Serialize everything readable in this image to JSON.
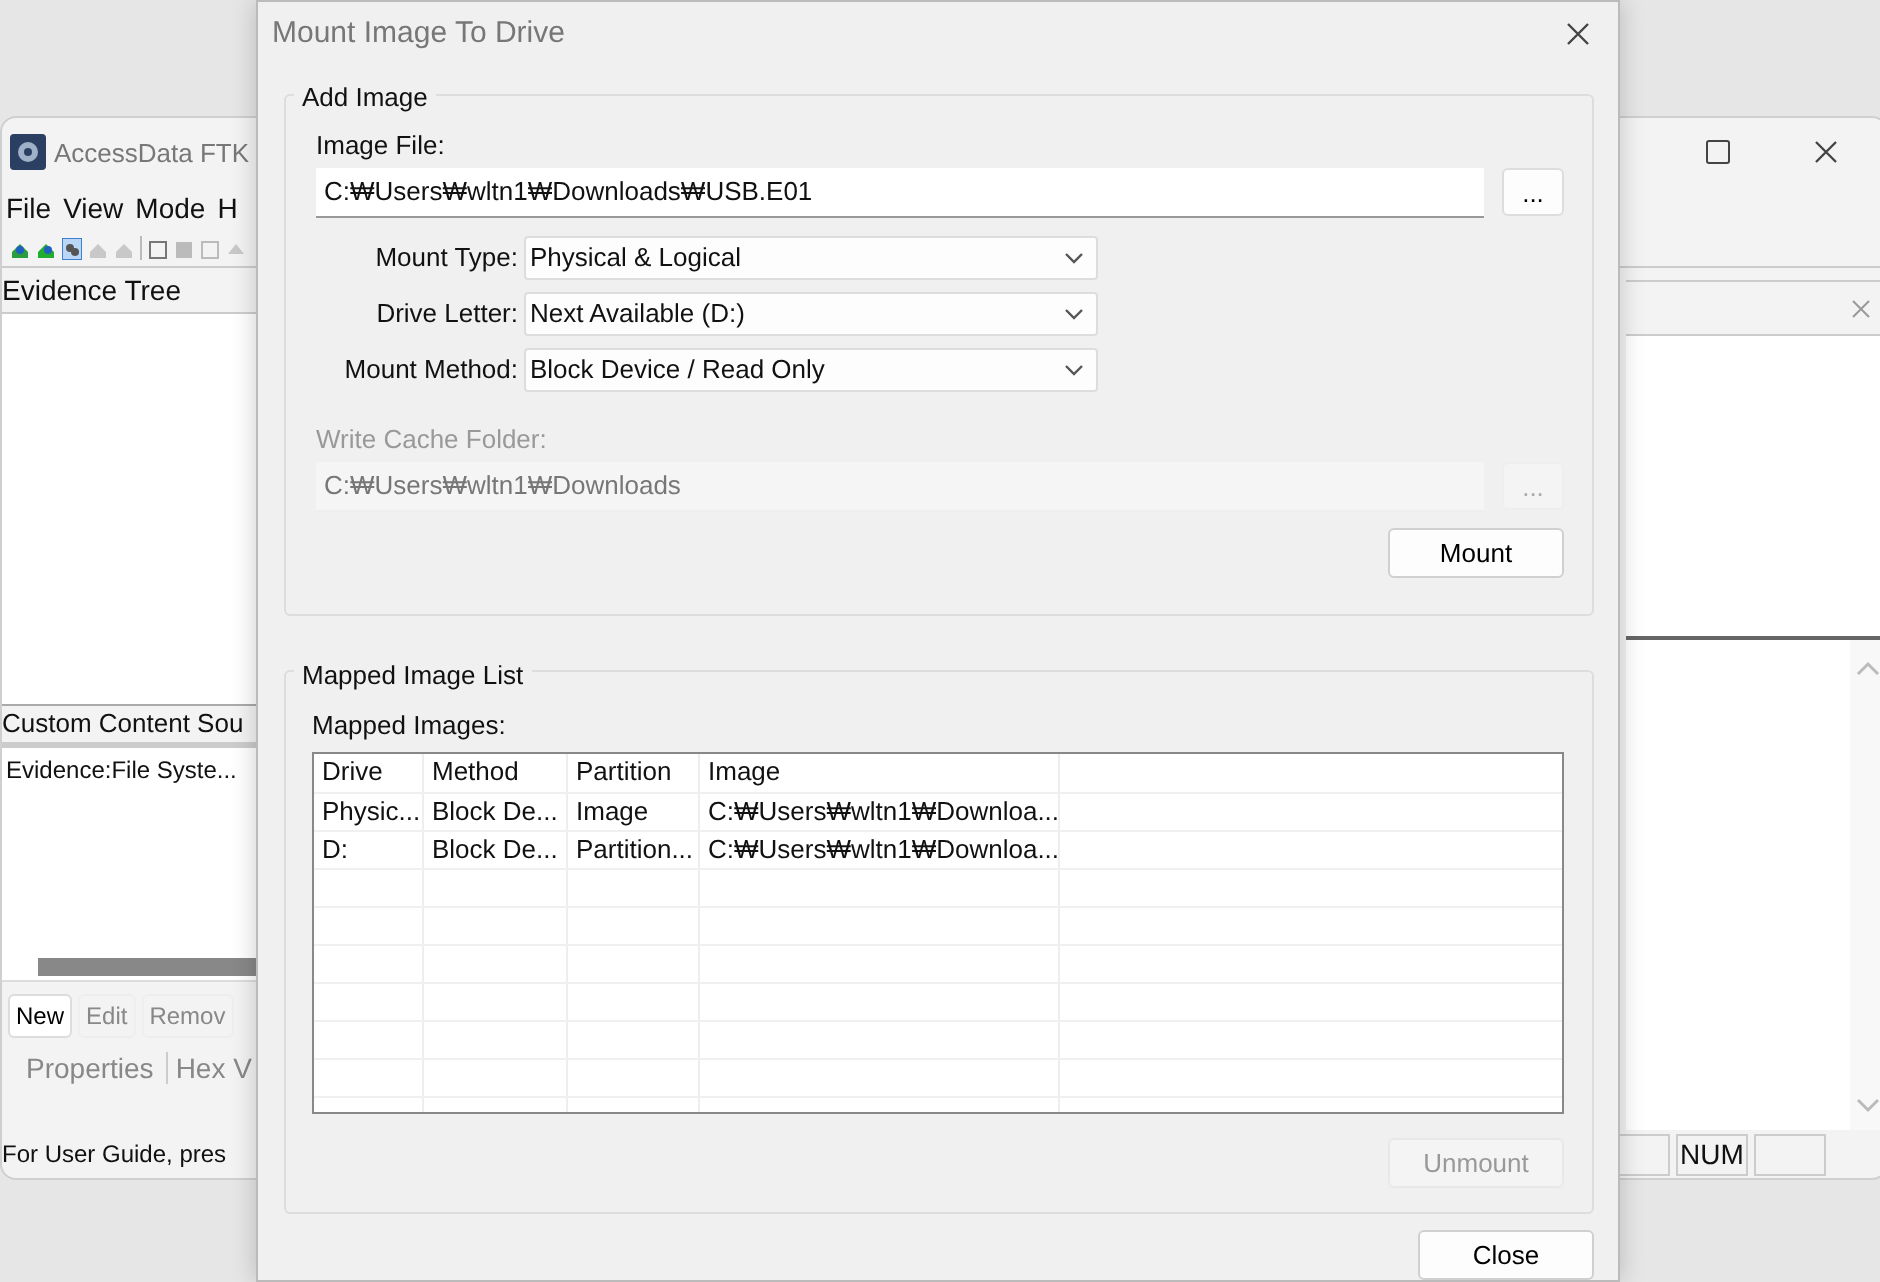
{
  "background_window": {
    "title": "AccessData FTK",
    "menu": [
      "File",
      "View",
      "Mode",
      "H"
    ],
    "evidence_tree": {
      "title": "Evidence Tree"
    },
    "custom_content": {
      "title": "Custom Content Sou",
      "items": [
        "Evidence:File Syste..."
      ],
      "buttons": [
        {
          "label": "New",
          "disabled": false
        },
        {
          "label": "Edit",
          "disabled": true
        },
        {
          "label": "Remov",
          "disabled": true
        }
      ]
    },
    "tabs": [
      {
        "label": "Properties",
        "selected": false
      },
      {
        "label": "Hex V",
        "selected": false
      }
    ],
    "status_bar": {
      "text": "For User Guide, pres",
      "indicators": [
        "NUM"
      ]
    }
  },
  "dialog": {
    "title": "Mount Image To Drive",
    "add_image": {
      "title": "Add Image",
      "image_file": {
        "label": "Image File:",
        "value": "C:₩Users₩wltn1₩Downloads₩USB.E01",
        "browse": "..."
      },
      "options": [
        {
          "label": "Mount Type:",
          "value": "Physical & Logical"
        },
        {
          "label": "Drive Letter:",
          "value": "Next Available (D:)"
        },
        {
          "label": "Mount Method:",
          "value": "Block Device / Read Only"
        }
      ],
      "write_cache": {
        "label": "Write Cache Folder:",
        "value": "C:₩Users₩wltn1₩Downloads",
        "browse": "...",
        "disabled": true
      },
      "mount_button": {
        "label": "Mount",
        "disabled": false
      }
    },
    "mapped_list": {
      "title": "Mapped Image List",
      "label": "Mapped Images:",
      "columns": [
        "Drive",
        "Method",
        "Partition",
        "Image"
      ],
      "rows": [
        [
          "Physic...",
          "Block De...",
          "Image",
          "C:₩Users₩wltn1₩Downloa..."
        ],
        [
          "D:",
          "Block De...",
          "Partition...",
          "C:₩Users₩wltn1₩Downloa..."
        ]
      ],
      "unmount_button": {
        "label": "Unmount",
        "disabled": true
      }
    },
    "close_button": {
      "label": "Close",
      "disabled": false
    }
  }
}
